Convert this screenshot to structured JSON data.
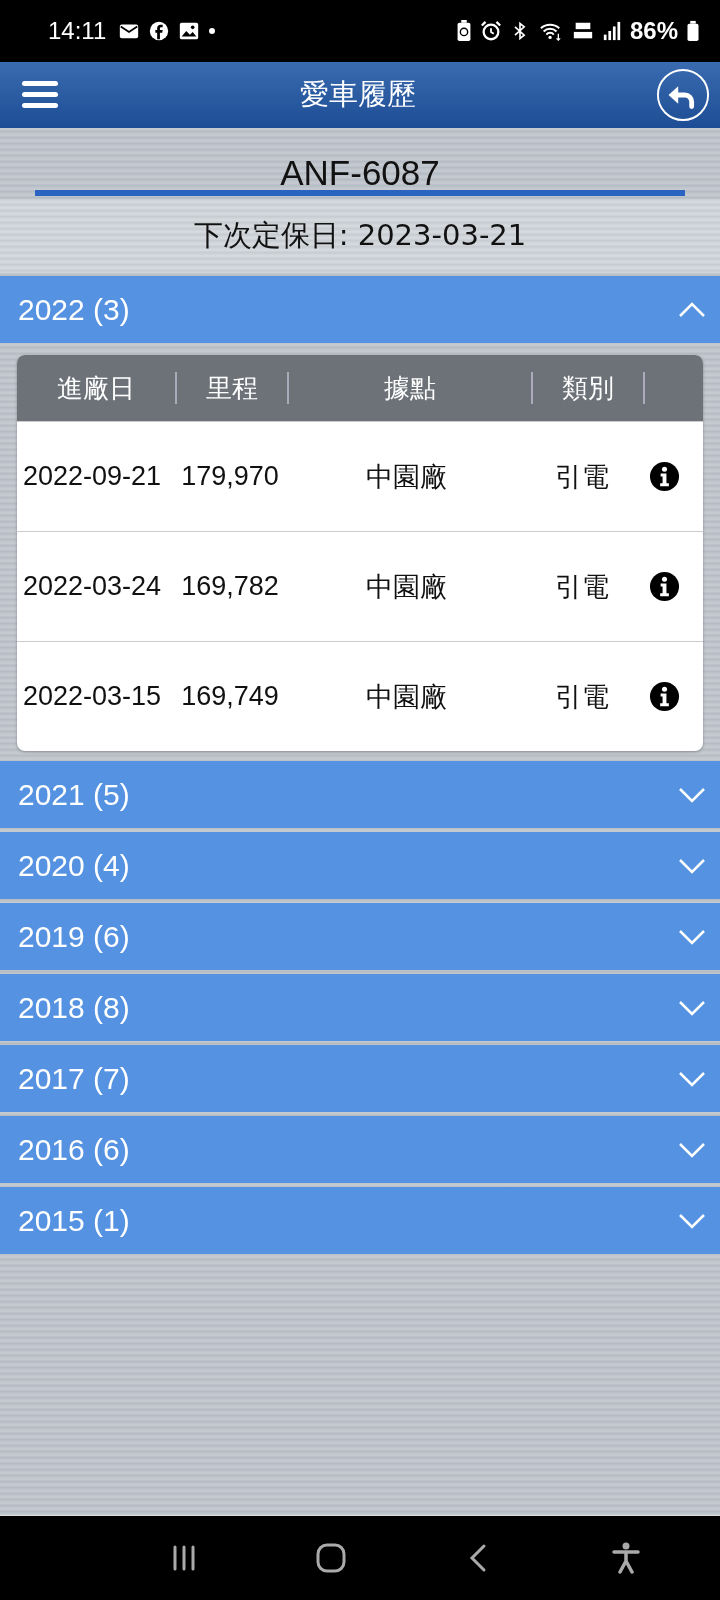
{
  "status_bar": {
    "time": "14:11",
    "battery": "86%"
  },
  "header": {
    "title": "愛車履歷"
  },
  "plate": "ANF-6087",
  "next_service": "下次定保日: 2023-03-21",
  "groups": [
    {
      "label": "2022 (3)",
      "expanded": true,
      "columns": [
        "進廠日",
        "里程",
        "據點",
        "類別"
      ],
      "rows": [
        {
          "date": "2022-09-21",
          "mileage": "179,970",
          "location": "中園廠",
          "category": "引電"
        },
        {
          "date": "2022-03-24",
          "mileage": "169,782",
          "location": "中園廠",
          "category": "引電"
        },
        {
          "date": "2022-03-15",
          "mileage": "169,749",
          "location": "中園廠",
          "category": "引電"
        }
      ]
    },
    {
      "label": "2021 (5)",
      "expanded": false
    },
    {
      "label": "2020 (4)",
      "expanded": false
    },
    {
      "label": "2019 (6)",
      "expanded": false
    },
    {
      "label": "2018 (8)",
      "expanded": false
    },
    {
      "label": "2017 (7)",
      "expanded": false
    },
    {
      "label": "2016 (6)",
      "expanded": false
    },
    {
      "label": "2015 (1)",
      "expanded": false
    }
  ]
}
